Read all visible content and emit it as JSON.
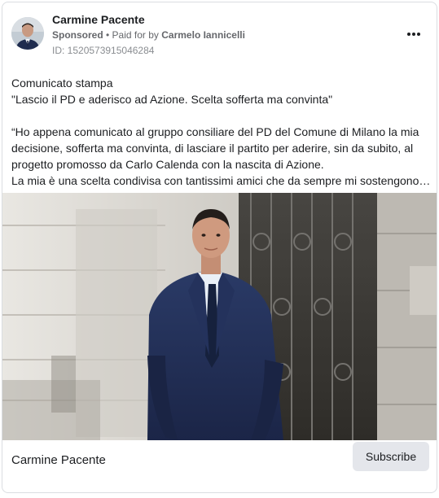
{
  "post": {
    "author": "Carmine Pacente",
    "sponsored": "Sponsored",
    "separator": " • ",
    "paid_for_prefix": "Paid for by ",
    "paid_for_name": "Carmelo Iannicelli",
    "ad_id": "ID: 1520573915046284",
    "body_lines": [
      "Comunicato stampa",
      "\"Lascio il PD e aderisco ad Azione. Scelta sofferta ma convinta\"",
      "",
      "“Ho appena comunicato al gruppo consiliare del PD del Comune di Milano la mia",
      "decisione, sofferta ma convinta, di lasciare il partito per aderire, sin da subito, al",
      "progetto promosso da Carlo Calenda con la nascita di Azione.",
      "La mia è una scelta condivisa con tantissimi amici che da sempre mi sostengono…"
    ]
  },
  "footer": {
    "page_name": "Carmine Pacente",
    "subscribe_label": "Subscribe"
  },
  "icons": {
    "more": "more-options-icon"
  }
}
